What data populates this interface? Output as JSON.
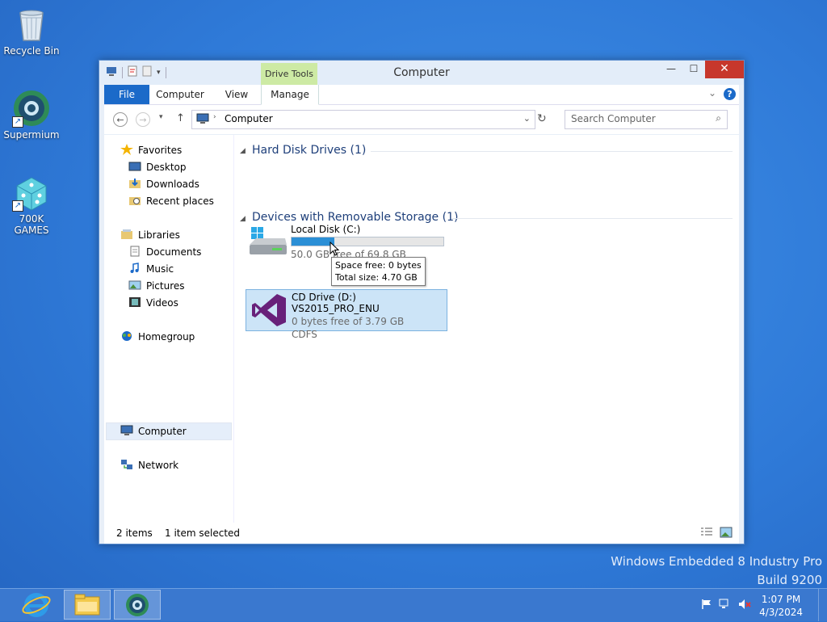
{
  "desktop": {
    "icons": [
      {
        "label": "Recycle Bin"
      },
      {
        "label": "Supermium"
      },
      {
        "label": "700K GAMES"
      }
    ],
    "watermark": {
      "line1": "Windows Embedded 8 Industry Pro",
      "line2": "Build 9200"
    }
  },
  "window": {
    "title": "Computer",
    "contextual_tab_group": "Drive Tools",
    "ribbon_tabs": [
      "File",
      "Computer",
      "View",
      "Manage"
    ],
    "address": {
      "path": "Computer"
    },
    "search": {
      "placeholder": "Search Computer"
    },
    "nav": {
      "favorites": "Favorites",
      "desktop": "Desktop",
      "downloads": "Downloads",
      "recent": "Recent places",
      "libraries": "Libraries",
      "documents": "Documents",
      "music": "Music",
      "pictures": "Pictures",
      "videos": "Videos",
      "homegroup": "Homegroup",
      "computer": "Computer",
      "network": "Network"
    },
    "groups": {
      "hdd": "Hard Disk Drives (1)",
      "removable": "Devices with Removable Storage (1)"
    },
    "drives": {
      "c": {
        "name": "Local Disk (C:)",
        "free": "50.0 GB free of 69.8 GB",
        "used_fraction": 0.28
      },
      "d": {
        "name": "CD Drive (D:) VS2015_PRO_ENU",
        "free": "0 bytes free of 3.79 GB",
        "fs": "CDFS"
      }
    },
    "tooltip": {
      "line1": "Space free: 0 bytes",
      "line2": "Total size: 4.70 GB"
    },
    "status": {
      "items": "2 items",
      "selected": "1 item selected"
    }
  },
  "taskbar": {
    "time": "1:07 PM",
    "date": "4/3/2024"
  },
  "colors": {
    "accent": "#1b6ac9",
    "drive_tools": "#cdeaa4",
    "close": "#c7372c",
    "bar": "#2b8fd6"
  }
}
